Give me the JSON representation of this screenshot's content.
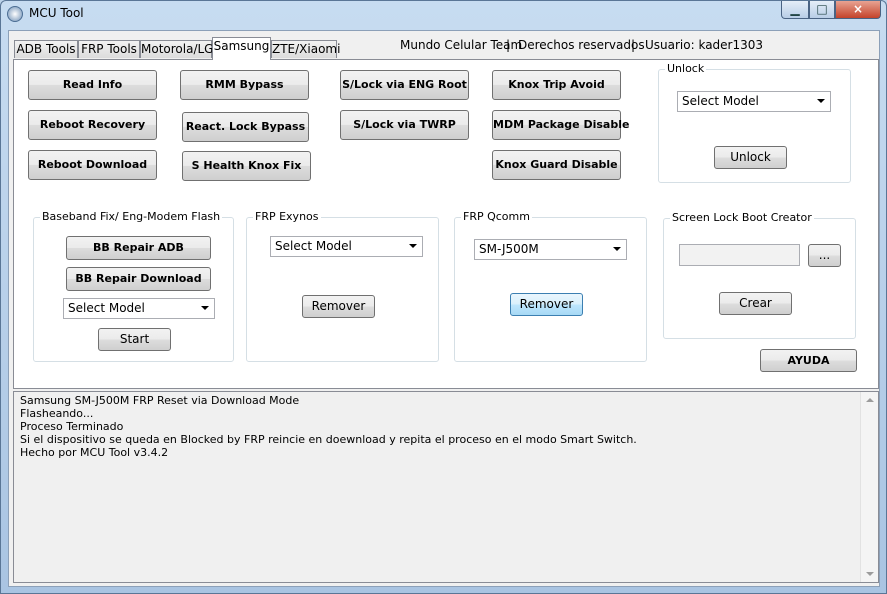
{
  "window": {
    "title": "MCU Tool",
    "close_glyph": "×",
    "minimize_glyph": "▁",
    "maximize_glyph": "□"
  },
  "tabs": [
    {
      "label": "ADB Tools"
    },
    {
      "label": "FRP Tools"
    },
    {
      "label": "Motorola/LG"
    },
    {
      "label": "Samsung"
    },
    {
      "label": "ZTE/Xiaomi"
    }
  ],
  "header": {
    "team": "Mundo Celular Team",
    "sep": "|",
    "rights": "Derechos  reservados",
    "user": "Usuario: kader1303"
  },
  "buttons": {
    "read_info": "Read Info",
    "reboot_recovery": "Reboot Recovery",
    "reboot_download": "Reboot Download",
    "rmm_bypass": "RMM Bypass",
    "react_lock_bypass": "React. Lock Bypass",
    "s_health_knox_fix": "S Health Knox Fix",
    "slock_eng_root": "S/Lock via ENG Root",
    "slock_twrp": "S/Lock via TWRP",
    "knox_trip_avoid": "Knox Trip Avoid",
    "mdm_package_disable": "MDM Package Disable",
    "knox_guard_disable": "Knox Guard Disable",
    "ayuda": "AYUDA"
  },
  "unlock": {
    "label": "Unlock",
    "select": "Select Model",
    "button": "Unlock"
  },
  "baseband": {
    "label": "Baseband Fix/ Eng-Modem Flash",
    "bb_repair_adb": "BB Repair ADB",
    "bb_repair_download": "BB Repair Download",
    "select": "Select Model",
    "start": "Start"
  },
  "frp_exynos": {
    "label": "FRP Exynos",
    "select": "Select Model",
    "button": "Remover"
  },
  "frp_qcomm": {
    "label": "FRP Qcomm",
    "select": "SM-J500M",
    "button": "Remover"
  },
  "screen_lock": {
    "label": "Screen Lock Boot Creator",
    "path_value": "",
    "browse": "...",
    "button": "Crear"
  },
  "log": [
    "Samsung SM-J500M FRP Reset via Download Mode",
    "Flasheando...",
    "Proceso Terminado",
    "Si el dispositivo se queda en Blocked by FRP reincie en doewnload y repita el proceso en el modo Smart Switch.",
    "Hecho por MCU Tool v3.4.2"
  ]
}
